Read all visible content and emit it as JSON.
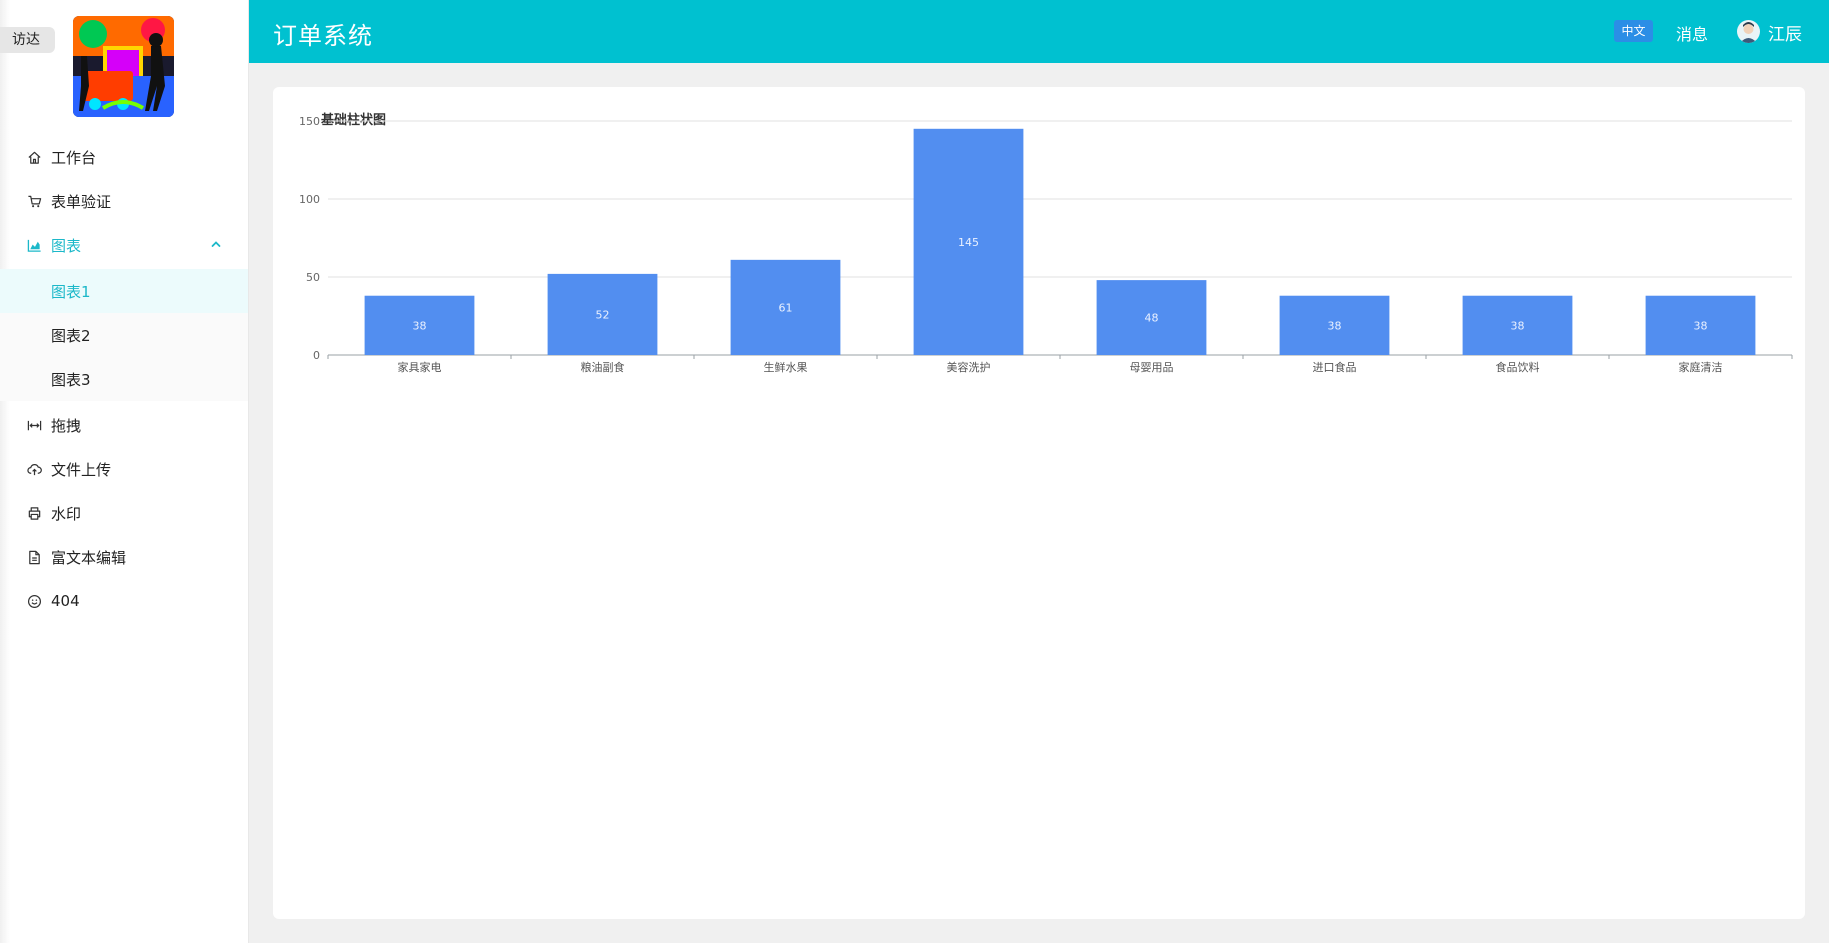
{
  "finder_tag": "访达",
  "header": {
    "title": "订单系统",
    "lang": "中文",
    "messages": "消息",
    "username": "江辰"
  },
  "sidebar": {
    "items": [
      {
        "label": "工作台",
        "icon": "home-icon"
      },
      {
        "label": "表单验证",
        "icon": "cart-icon"
      },
      {
        "label": "图表",
        "icon": "area-chart-icon",
        "open": true,
        "children": [
          {
            "label": "图表1",
            "active": true
          },
          {
            "label": "图表2"
          },
          {
            "label": "图表3"
          }
        ]
      },
      {
        "label": "拖拽",
        "icon": "drag-icon"
      },
      {
        "label": "文件上传",
        "icon": "cloud-upload-icon"
      },
      {
        "label": "水印",
        "icon": "printer-icon"
      },
      {
        "label": "富文本编辑",
        "icon": "document-icon"
      },
      {
        "label": "404",
        "icon": "smile-icon"
      }
    ]
  },
  "colors": {
    "header_bg": "#00c1d0",
    "accent": "#1cb8c9",
    "bar": "#528ef0",
    "lang_btn": "#2b8ee6"
  },
  "chart_data": {
    "type": "bar",
    "title": "基础柱状图",
    "categories": [
      "家具家电",
      "粮油副食",
      "生鲜水果",
      "美容洗护",
      "母婴用品",
      "进口食品",
      "食品饮料",
      "家庭清洁"
    ],
    "values": [
      38,
      52,
      61,
      145,
      48,
      38,
      38,
      38
    ],
    "yticks": [
      0,
      50,
      100,
      150
    ],
    "ylim": [
      0,
      150
    ],
    "grid": true,
    "data_labels": true,
    "xlabel": "",
    "ylabel": ""
  }
}
